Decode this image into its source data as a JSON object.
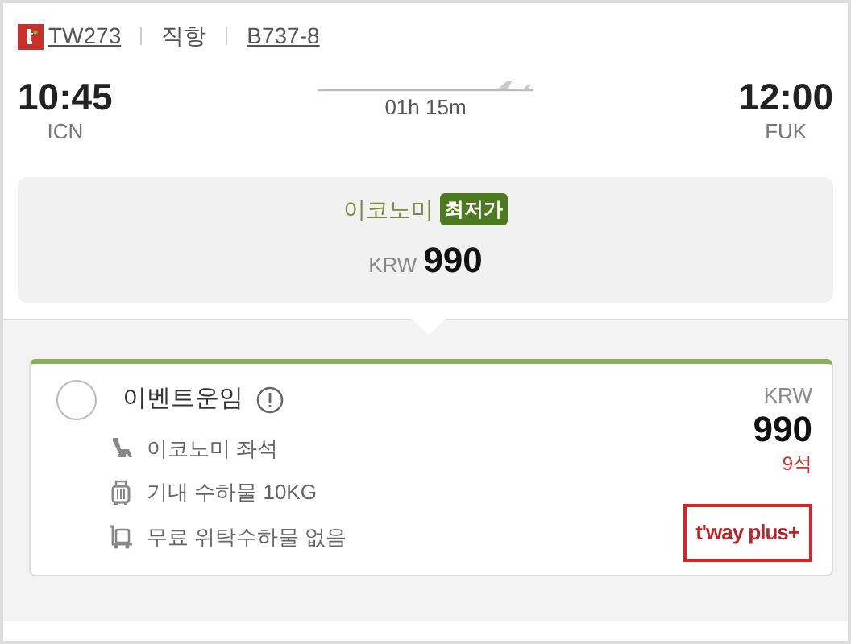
{
  "flight": {
    "number": "TW273",
    "type": "직항",
    "aircraft": "B737-8"
  },
  "departure": {
    "time": "10:45",
    "airport": "ICN"
  },
  "duration": "01h 15m",
  "arrival": {
    "time": "12:00",
    "airport": "FUK"
  },
  "summary": {
    "cabin": "이코노미",
    "badge": "최저가",
    "currency": "KRW",
    "price": "990"
  },
  "fare": {
    "name": "이벤트운임",
    "selected": false,
    "currency": "KRW",
    "price": "990",
    "seats": "9석",
    "brand": "t'way plus+",
    "features": [
      {
        "kind": "seat",
        "text": "이코노미 좌석"
      },
      {
        "kind": "cabin-bag",
        "text": "기내 수하물 10KG"
      },
      {
        "kind": "no-checked-bag",
        "text": "무료 위탁수하물 없음"
      }
    ]
  }
}
